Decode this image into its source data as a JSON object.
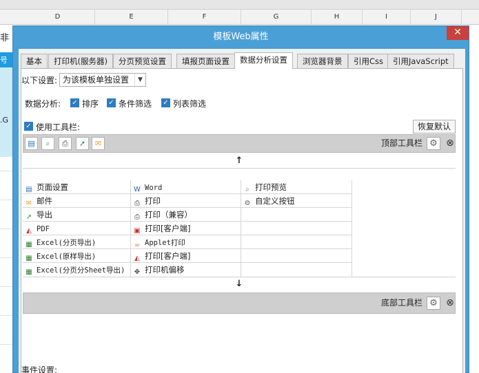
{
  "spreadsheet": {
    "columns": [
      "D",
      "E",
      "F",
      "G",
      "H",
      "I",
      "J"
    ],
    "fragments": [
      "非",
      "号",
      ".G"
    ]
  },
  "dialog": {
    "title": "模板Web属性",
    "close_symbol": "✕"
  },
  "tabs": [
    {
      "label": "基本"
    },
    {
      "label": "打印机(服务器)"
    },
    {
      "label": "分页预览设置"
    },
    {
      "label": "填报页面设置"
    },
    {
      "label": "数据分析设置",
      "active": true
    },
    {
      "label": "浏览器背景"
    },
    {
      "label": "引用Css"
    },
    {
      "label": "引用JavaScript"
    }
  ],
  "settings": {
    "scope_label": "以下设置:",
    "scope_value": "为该模板单独设置",
    "analysis_label": "数据分析:",
    "checkboxes": [
      "排序",
      "条件筛选",
      "列表筛选"
    ],
    "use_toolbar": "使用工具栏:",
    "restore_default": "恢复默认"
  },
  "toolbar": {
    "top_label": "顶部工具栏",
    "bottom_label": "底部工具栏",
    "up_arrow": "↑",
    "down_arrow": "↓"
  },
  "items": {
    "col1": [
      "页面设置",
      "邮件",
      "导出",
      "PDF",
      "Excel(分页导出)",
      "Excel(原样导出)",
      "Excel(分页分Sheet导出)"
    ],
    "col2": [
      "Word",
      "打印",
      "打印（兼容）",
      "打印[客户端]",
      "Applet打印",
      "打印[客户端]",
      "打印机偏移"
    ],
    "col3": [
      "打印预览",
      "自定义按钮"
    ]
  },
  "events": {
    "label": "事件设置:",
    "add_symbol": "+",
    "caret": "▾",
    "edit_symbol": "✎",
    "delete_symbol": "✕"
  },
  "colors": {
    "titlebar": "#4a9fd6",
    "close": "#c9413a",
    "checkbox": "#2d7cc0",
    "highlight": "#e03030"
  }
}
